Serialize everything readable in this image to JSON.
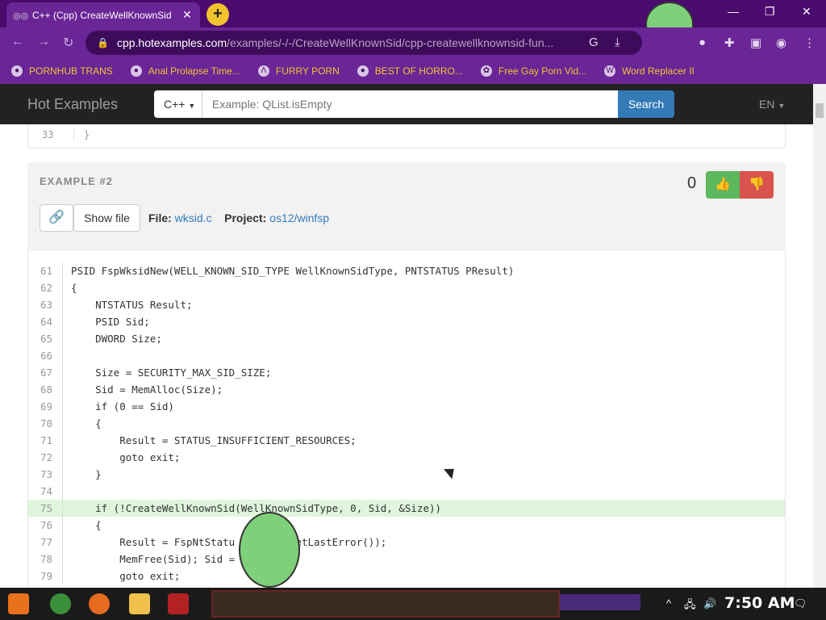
{
  "browser": {
    "tab_title": "C++ (Cpp) CreateWellKnownSid",
    "url_host": "cpp.hotexamples.com",
    "url_path": "/examples/-/-/CreateWellKnownSid/cpp-createwellknownsid-fun...",
    "bookmarks": [
      {
        "label": "PORNHUB TRANS"
      },
      {
        "label": "Anal Prolapse Time..."
      },
      {
        "label": "FURRY PORN"
      },
      {
        "label": "BEST OF HORRO..."
      },
      {
        "label": "Free Gay Porn Vid..."
      },
      {
        "label": "Word Replacer II"
      }
    ]
  },
  "site": {
    "brand": "Hot Examples",
    "language_select": "C++",
    "search_placeholder": "Example: QList.isEmpty",
    "search_button": "Search",
    "locale": "EN"
  },
  "previous_snippet": {
    "line_number": "33",
    "text": "}"
  },
  "example": {
    "label": "EXAMPLE #2",
    "vote_count": "0",
    "show_file": "Show file",
    "file_label": "File:",
    "file_name": "wksid.c",
    "project_label": "Project:",
    "project_name": "os12/winfsp"
  },
  "code_lines": [
    {
      "n": "61",
      "text": "PSID FspWksidNew(WELL_KNOWN_SID_TYPE WellKnownSidType, PNTSTATUS PResult)"
    },
    {
      "n": "62",
      "text": "{"
    },
    {
      "n": "63",
      "text": "    NTSTATUS Result;"
    },
    {
      "n": "64",
      "text": "    PSID Sid;"
    },
    {
      "n": "65",
      "text": "    DWORD Size;"
    },
    {
      "n": "66",
      "text": ""
    },
    {
      "n": "67",
      "text": "    Size = SECURITY_MAX_SID_SIZE;"
    },
    {
      "n": "68",
      "text": "    Sid = MemAlloc(Size);"
    },
    {
      "n": "69",
      "text": "    if (0 == Sid)"
    },
    {
      "n": "70",
      "text": "    {"
    },
    {
      "n": "71",
      "text": "        Result = STATUS_INSUFFICIENT_RESOURCES;"
    },
    {
      "n": "72",
      "text": "        goto exit;"
    },
    {
      "n": "73",
      "text": "    }"
    },
    {
      "n": "74",
      "text": ""
    },
    {
      "n": "75",
      "text": "    if (!CreateWellKnownSid(WellKnownSidType, 0, Sid, &Size))",
      "highlight": true
    },
    {
      "n": "76",
      "text": "    {"
    },
    {
      "n": "77",
      "text": "        Result = FspNtStatu        (GetLastError());"
    },
    {
      "n": "78",
      "text": "        MemFree(Sid); Sid = 0;"
    },
    {
      "n": "79",
      "text": "        goto exit;"
    }
  ],
  "taskbar": {
    "clock": "7:50 AM"
  },
  "colors": {
    "browser_frame": "#4b0a6e",
    "toolbar": "#6a2596",
    "bookmark_text": "#f3c533",
    "highlight_line": "#dff5dc",
    "upvote": "#5cb85c",
    "downvote": "#d9534f",
    "search_button": "#337ab7"
  }
}
